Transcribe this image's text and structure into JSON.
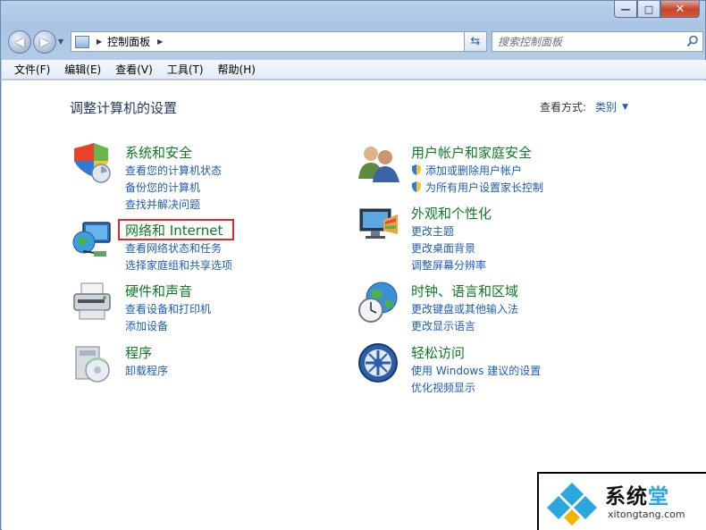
{
  "window": {
    "minimize_glyph": "—",
    "maximize_glyph": "□",
    "close_glyph": "✕"
  },
  "address_bar": {
    "path": "控制面板",
    "search_placeholder": "搜索控制面板"
  },
  "menu": [
    "文件(F)",
    "编辑(E)",
    "查看(V)",
    "工具(T)",
    "帮助(H)"
  ],
  "main": {
    "title": "调整计算机的设置",
    "view_by_label": "查看方式:",
    "view_by_value": "类别"
  },
  "categories": {
    "system_security": {
      "title": "系统和安全",
      "icon": "shield-icon",
      "links": [
        "查看您的计算机状态",
        "备份您的计算机",
        "查找并解决问题"
      ]
    },
    "network": {
      "title": "网络和 Internet",
      "icon": "network-globe-icon",
      "links": [
        "查看网络状态和任务",
        "选择家庭组和共享选项"
      ]
    },
    "hardware": {
      "title": "硬件和声音",
      "icon": "printer-icon",
      "links": [
        "查看设备和打印机",
        "添加设备"
      ]
    },
    "programs": {
      "title": "程序",
      "icon": "programs-disc-icon",
      "links": [
        "卸载程序"
      ]
    },
    "user_accounts": {
      "title": "用户帐户和家庭安全",
      "icon": "users-icon",
      "links": [
        "添加或删除用户帐户",
        "为所有用户设置家长控制"
      ]
    },
    "appearance": {
      "title": "外观和个性化",
      "icon": "monitor-palette-icon",
      "links": [
        "更改主题",
        "更改桌面背景",
        "调整屏幕分辨率"
      ]
    },
    "clock_region": {
      "title": "时钟、语言和区域",
      "icon": "clock-globe-icon",
      "links": [
        "更改键盘或其他输入法",
        "更改显示语言"
      ]
    },
    "ease_access": {
      "title": "轻松访问",
      "icon": "ease-of-access-icon",
      "links": [
        "使用 Windows 建议的设置",
        "优化视频显示"
      ]
    }
  },
  "watermark": {
    "title_part1": "系统",
    "title_part2": "堂",
    "url": "xitongtang.com"
  },
  "colors": {
    "category_title": "#0e7a26",
    "link": "#1e5cb5",
    "highlight": "#e02a2a"
  }
}
